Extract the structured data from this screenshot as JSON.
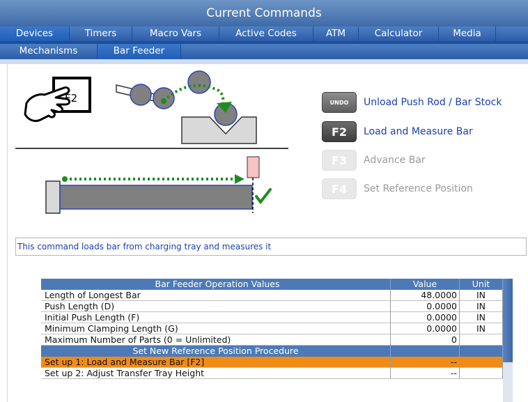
{
  "window": {
    "title": "Current Commands"
  },
  "tabs_primary": [
    {
      "label": "Devices",
      "active": true
    },
    {
      "label": "Timers",
      "active": false
    },
    {
      "label": "Macro Vars",
      "active": false
    },
    {
      "label": "Active Codes",
      "active": false
    },
    {
      "label": "ATM",
      "active": false
    },
    {
      "label": "Calculator",
      "active": false
    },
    {
      "label": "Media",
      "active": false
    }
  ],
  "tabs_secondary": [
    {
      "label": "Mechanisms",
      "active": false
    },
    {
      "label": "Bar Feeder",
      "active": true
    }
  ],
  "illustration": {
    "key_label": "F2"
  },
  "commands": [
    {
      "key": "UNDO",
      "label": "Unload Push Rod / Bar Stock",
      "enabled": true
    },
    {
      "key": "F2",
      "label": "Load and Measure Bar",
      "enabled": true
    },
    {
      "key": "F3",
      "label": "Advance Bar",
      "enabled": false
    },
    {
      "key": "F4",
      "label": "Set Reference Position",
      "enabled": false
    }
  ],
  "description": "This command loads bar from charging tray and measures it",
  "table": {
    "headers": {
      "name": "Bar Feeder Operation Values",
      "value": "Value",
      "unit": "Unit"
    },
    "rows": [
      {
        "name": "Length of Longest Bar",
        "value": "48.0000",
        "unit": "IN"
      },
      {
        "name": "Push Length (D)",
        "value": "0.0000",
        "unit": "IN"
      },
      {
        "name": "Initial Push Length (F)",
        "value": "0.0000",
        "unit": "IN"
      },
      {
        "name": "Minimum Clamping Length (G)",
        "value": "0.0000",
        "unit": "IN"
      },
      {
        "name": "Maximum Number of Parts (0 = Unlimited)",
        "value": "0",
        "unit": ""
      }
    ],
    "section_title": "Set New Reference Position Procedure",
    "procedure": [
      {
        "name": "Set up 1: Load and Measure Bar [F2]",
        "value": "--",
        "unit": "",
        "selected": true
      },
      {
        "name": "Set up 2: Adjust Transfer Tray Height",
        "value": "--",
        "unit": "",
        "selected": false
      }
    ]
  },
  "colors": {
    "title_bar": "#3f6aa6",
    "tab_bar": "#2c5ca8",
    "command_text": "#1a3fb5",
    "selected_row": "#f08c16",
    "table_header": "#4d7ab6",
    "arrow_green": "#1e8c1e"
  }
}
